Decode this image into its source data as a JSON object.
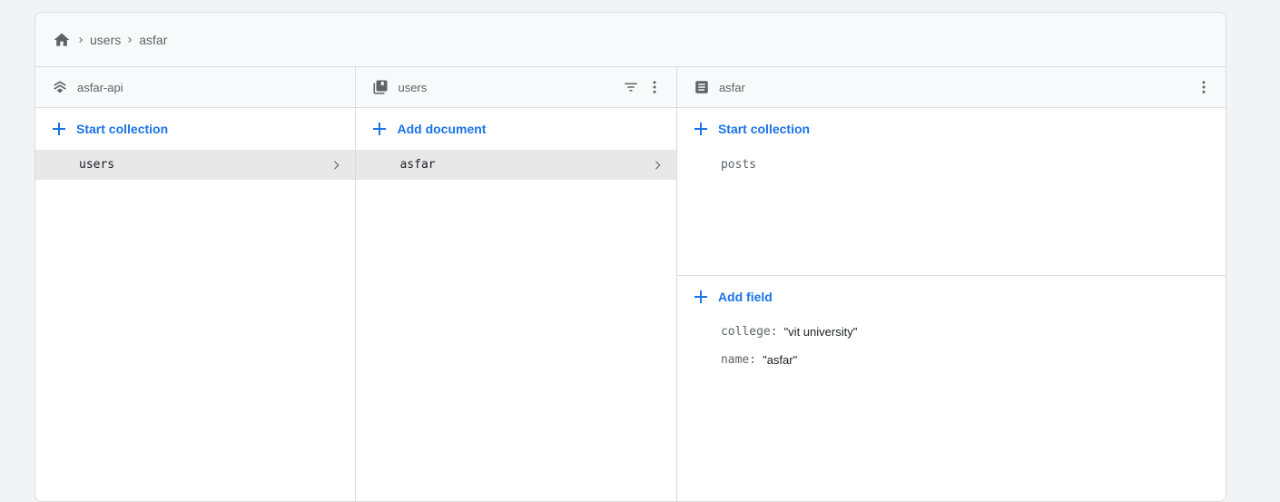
{
  "breadcrumb": {
    "home_icon": "home-icon",
    "separator_icon": "chevron-right-icon",
    "items": [
      "users",
      "asfar"
    ]
  },
  "columns": {
    "project": {
      "title": "asfar-api",
      "icon": "firestore-project-icon",
      "add_label": "Start collection",
      "items": [
        {
          "label": "users",
          "selected": true
        }
      ]
    },
    "collection": {
      "title": "users",
      "icon": "collection-icon",
      "actions": [
        "filter-icon",
        "more-vert-icon"
      ],
      "add_label": "Add document",
      "items": [
        {
          "label": "asfar",
          "selected": true
        }
      ]
    },
    "document": {
      "title": "asfar",
      "icon": "document-icon",
      "actions": [
        "more-vert-icon"
      ],
      "add_collection_label": "Start collection",
      "subcollections": [
        "posts"
      ],
      "add_field_label": "Add field",
      "fields": [
        {
          "key": "college",
          "value": "\"vit university\""
        },
        {
          "key": "name",
          "value": "\"asfar\""
        }
      ]
    }
  },
  "colors": {
    "accent": "#1a73e8",
    "header_bg": "#f8f9fa",
    "selected_bg": "#e8e8e8",
    "border": "#dadce0",
    "muted_text": "#5f6368"
  }
}
